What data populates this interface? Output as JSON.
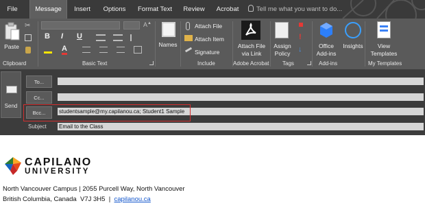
{
  "tabs": [
    {
      "label": "File",
      "active": false
    },
    {
      "label": "Message",
      "active": true
    },
    {
      "label": "Insert",
      "active": false
    },
    {
      "label": "Options",
      "active": false
    },
    {
      "label": "Format Text",
      "active": false
    },
    {
      "label": "Review",
      "active": false
    },
    {
      "label": "Acrobat",
      "active": false
    }
  ],
  "tell_me": "Tell me what you want to do...",
  "ribbon": {
    "clipboard": {
      "paste": "Paste",
      "label": "Clipboard"
    },
    "basic_text": {
      "label": "Basic Text",
      "bold": "B",
      "italic": "I",
      "underline": "U",
      "font_color": "A"
    },
    "names": {
      "button": "Names"
    },
    "include": {
      "attach_file": "Attach File",
      "attach_item": "Attach Item",
      "signature": "Signature",
      "label": "Include"
    },
    "acrobat": {
      "button_line1": "Attach File",
      "button_line2": "via Link",
      "label": "Adobe Acrobat"
    },
    "tags": {
      "assign_line1": "Assign",
      "assign_line2": "Policy",
      "label": "Tags"
    },
    "addins": {
      "office_line1": "Office",
      "office_line2": "Add-ins",
      "insights": "Insights",
      "label": "Add-ins"
    },
    "templates": {
      "view_line1": "View",
      "view_line2": "Templates",
      "label": "My Templates"
    }
  },
  "colors": {
    "accent_red": "#d32f2f",
    "link": "#1155cc",
    "tab_bar": "#3a3a3a",
    "ribbon": "#5a5a5a"
  },
  "compose": {
    "send": "Send",
    "to_button": "To...",
    "cc_button": "Cc...",
    "bcc_button": "Bcc...",
    "to_value": "",
    "cc_value": "",
    "bcc_value": "studentsample@my.capilanou.ca; Student1 Sample",
    "subject_label": "Subject",
    "subject_value": "Email to the Class"
  },
  "body": {
    "logo_line1": "CAPILANO",
    "logo_line2": "UNIVERSITY",
    "sig_line1": "North Vancouver Campus  |  2055 Purcell Way, North Vancouver",
    "sig_line2_prefix": "British Columbia, Canada  V7J 3H5  |  ",
    "sig_link": "capilanou.ca"
  }
}
